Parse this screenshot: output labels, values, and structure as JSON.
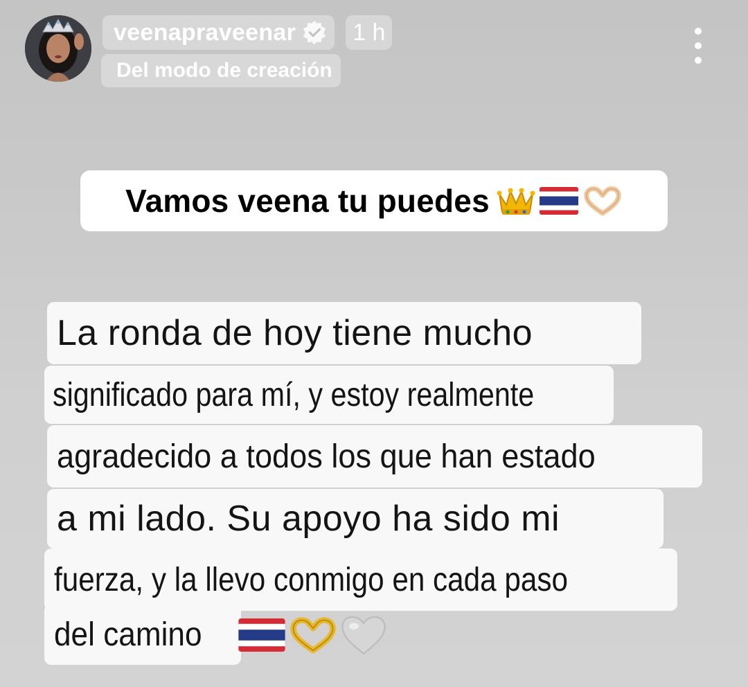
{
  "header": {
    "username": "veenapraveenar",
    "time_ago": "1 h",
    "mode_label": "Del modo de creación",
    "avatar_icon": "profile-photo",
    "verified_icon": "verified-badge-icon",
    "menu_icon": "more-vertical-icon"
  },
  "title_sticker": {
    "text": "Vamos veena tu puedes",
    "emojis": [
      "crown-emoji",
      "thailand-flag-emoji",
      "heart-hands-emoji"
    ]
  },
  "caption": {
    "lines": [
      "La ronda de hoy tiene mucho",
      "significado para mí, y estoy realmente",
      "agradecido a todos los que han estado",
      "a mi lado. Su apoyo ha sido mi",
      "fuerza, y la llevo conmigo en cada paso",
      "del camino"
    ],
    "end_emojis": [
      "thailand-flag-emoji",
      "heart-hands-emoji",
      "white-heart-emoji"
    ]
  },
  "colors": {
    "background": "#c9c9c9",
    "chip": "rgba(255,255,255,0.32)",
    "sticker": "#ffffff",
    "caption_bg": "#f8f8f8",
    "text": "#141414"
  }
}
